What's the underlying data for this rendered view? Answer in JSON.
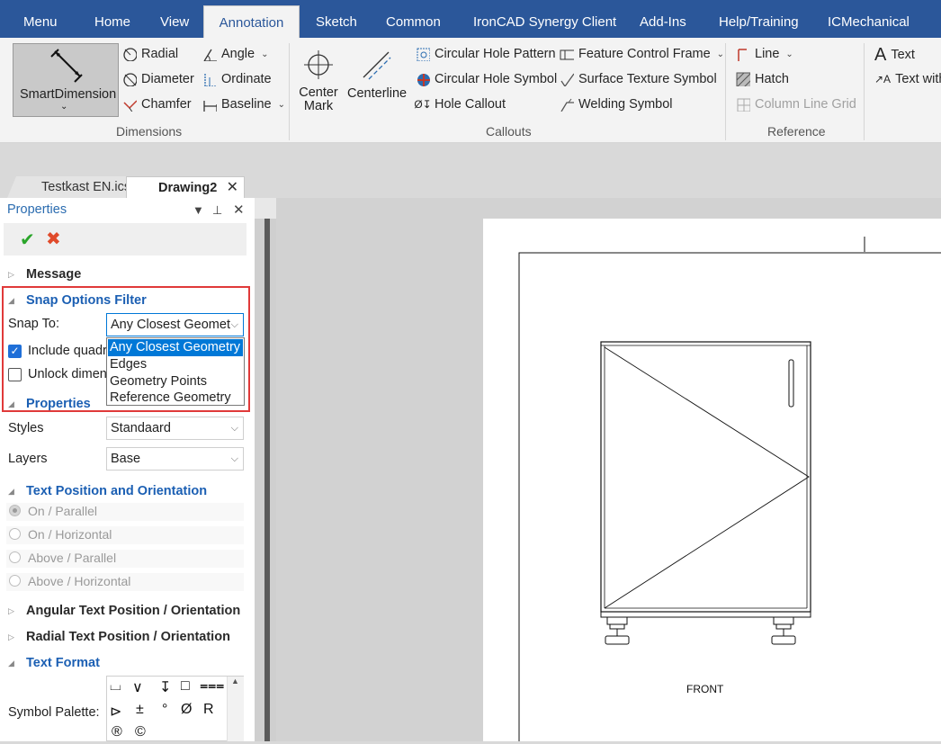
{
  "ribbon_tabs": [
    "Menu",
    "Home",
    "View",
    "Annotation",
    "Sketch",
    "Common",
    "IronCAD Synergy Client",
    "Add-Ins",
    "Help/Training",
    "ICMechanical"
  ],
  "active_tab": "Annotation",
  "ribbon": {
    "smart_dimension": "SmartDimension",
    "radial": "Radial",
    "diameter": "Diameter",
    "chamfer": "Chamfer",
    "angle": "Angle",
    "ordinate": "Ordinate",
    "baseline": "Baseline",
    "dimensions_group": "Dimensions",
    "center_mark": "Center Mark",
    "centerline": "Centerline",
    "circular_hole_pattern": "Circular Hole Pattern",
    "circular_hole_symbol": "Circular Hole Symbol",
    "hole_callout": "Hole Callout",
    "feature_control_frame": "Feature Control Frame",
    "surface_texture_symbol": "Surface Texture Symbol",
    "welding_symbol": "Welding Symbol",
    "callouts_group": "Callouts",
    "line": "Line",
    "hatch": "Hatch",
    "column_line_grid": "Column Line Grid",
    "reference_group": "Reference",
    "text": "Text",
    "text_with": "Text with"
  },
  "doc_tabs": [
    {
      "label": "Testkast EN.ics",
      "active": false
    },
    {
      "label": "Drawing2",
      "active": true
    }
  ],
  "properties_panel": {
    "title": "Properties",
    "sections": {
      "message": "Message",
      "snap_options": "Snap Options Filter",
      "properties": "Properties",
      "text_position": "Text Position and Orientation",
      "angular_text": "Angular Text Position / Orientation",
      "radial_text": "Radial Text Position / Orientation",
      "text_format": "Text Format"
    },
    "snap_to_label": "Snap To:",
    "snap_to_value": "Any Closest Geomet",
    "snap_options": [
      "Any Closest Geometry",
      "Edges",
      "Geometry Points",
      "Reference Geometry"
    ],
    "include_quadrant": {
      "label": "Include quadr",
      "checked": true
    },
    "unlock_dimension": {
      "label": "Unlock dimens",
      "checked": false
    },
    "styles_label": "Styles",
    "styles_value": "Standaard",
    "layers_label": "Layers",
    "layers_value": "Base",
    "text_positions": [
      "On / Parallel",
      "On / Horizontal",
      "Above / Parallel",
      "Above / Horizontal"
    ],
    "symbol_palette_label": "Symbol Palette:",
    "symbols": [
      "⌴",
      "∨",
      "↧",
      "□",
      "⩶",
      "⊳",
      "±",
      "°",
      "Ø",
      "R",
      "®",
      "©"
    ]
  },
  "drawing": {
    "view_label": "FRONT"
  },
  "colors": {
    "tab_bar": "#2b579a",
    "section_blue": "#1b5fb3",
    "selection": "#0078d7",
    "highlight_box": "#e03a3a"
  }
}
